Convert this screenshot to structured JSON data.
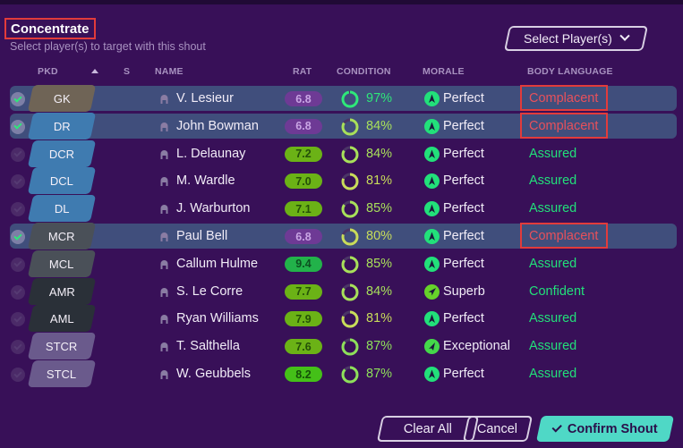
{
  "header": {
    "title": "Concentrate",
    "subtitle": "Select player(s) to target with this shout",
    "select_players_label": "Select Player(s)"
  },
  "columns": {
    "pkd": "PKD",
    "s": "S",
    "name": "NAME",
    "rat": "RAT",
    "condition": "CONDITION",
    "morale": "MORALE",
    "body_language": "BODY LANGUAGE"
  },
  "colors": {
    "background": "#381058",
    "selected_row": "#404e7c",
    "complacent": "#e8505b",
    "positive_body_language": "#22e07a",
    "confirm_button": "#4fd8c6",
    "highlight_box": "#e23b3b"
  },
  "players": [
    {
      "selected": true,
      "position": "GK",
      "position_color": "#6f6456",
      "name": "V. Lesieur",
      "rating": "6.8",
      "rating_bg": "#6e3a95",
      "rating_fg": "#c9a5e4",
      "condition": "97%",
      "condition_value": 0.97,
      "condition_color": "#2ee87a",
      "morale": "Perfect",
      "morale_icon": "arrow-up-icon",
      "morale_icon_color": "#22e07a",
      "body_language": "Complacent",
      "body_language_color": "#e8505b",
      "highlighted": true
    },
    {
      "selected": true,
      "position": "DR",
      "position_color": "#3f7bb0",
      "name": "John Bowman",
      "rating": "6.8",
      "rating_bg": "#6e3a95",
      "rating_fg": "#c9a5e4",
      "condition": "84%",
      "condition_value": 0.84,
      "condition_color": "#a8e05a",
      "morale": "Perfect",
      "morale_icon": "arrow-up-icon",
      "morale_icon_color": "#22e07a",
      "body_language": "Complacent",
      "body_language_color": "#e8505b",
      "highlighted": true
    },
    {
      "selected": false,
      "position": "DCR",
      "position_color": "#3f7bb0",
      "name": "L. Delaunay",
      "rating": "7.2",
      "rating_bg": "#6bb216",
      "rating_fg": "#245008",
      "condition": "84%",
      "condition_value": 0.84,
      "condition_color": "#a8e05a",
      "morale": "Perfect",
      "morale_icon": "arrow-up-icon",
      "morale_icon_color": "#22e07a",
      "body_language": "Assured",
      "body_language_color": "#22e07a",
      "highlighted": false
    },
    {
      "selected": false,
      "position": "DCL",
      "position_color": "#3f7bb0",
      "name": "M. Wardle",
      "rating": "7.0",
      "rating_bg": "#6bb216",
      "rating_fg": "#245008",
      "condition": "81%",
      "condition_value": 0.81,
      "condition_color": "#c8dc5a",
      "morale": "Perfect",
      "morale_icon": "arrow-up-icon",
      "morale_icon_color": "#22e07a",
      "body_language": "Assured",
      "body_language_color": "#22e07a",
      "highlighted": false
    },
    {
      "selected": false,
      "position": "DL",
      "position_color": "#3f7bb0",
      "name": "J. Warburton",
      "rating": "7.1",
      "rating_bg": "#6bb216",
      "rating_fg": "#245008",
      "condition": "85%",
      "condition_value": 0.85,
      "condition_color": "#a8e05a",
      "morale": "Perfect",
      "morale_icon": "arrow-up-icon",
      "morale_icon_color": "#22e07a",
      "body_language": "Assured",
      "body_language_color": "#22e07a",
      "highlighted": false
    },
    {
      "selected": true,
      "position": "MCR",
      "position_color": "#4a5058",
      "name": "Paul Bell",
      "rating": "6.8",
      "rating_bg": "#6e3a95",
      "rating_fg": "#c9a5e4",
      "condition": "80%",
      "condition_value": 0.8,
      "condition_color": "#c8dc5a",
      "morale": "Perfect",
      "morale_icon": "arrow-up-icon",
      "morale_icon_color": "#22e07a",
      "body_language": "Complacent",
      "body_language_color": "#e8505b",
      "highlighted": true
    },
    {
      "selected": false,
      "position": "MCL",
      "position_color": "#4a5058",
      "name": "Callum Hulme",
      "rating": "9.4",
      "rating_bg": "#22b24a",
      "rating_fg": "#0c5020",
      "condition": "85%",
      "condition_value": 0.85,
      "condition_color": "#a8e05a",
      "morale": "Perfect",
      "morale_icon": "arrow-up-icon",
      "morale_icon_color": "#22e07a",
      "body_language": "Assured",
      "body_language_color": "#22e07a",
      "highlighted": false
    },
    {
      "selected": false,
      "position": "AMR",
      "position_color": "#2a3038",
      "name": "S. Le Corre",
      "rating": "7.7",
      "rating_bg": "#6bb216",
      "rating_fg": "#245008",
      "condition": "84%",
      "condition_value": 0.84,
      "condition_color": "#a8e05a",
      "morale": "Superb",
      "morale_icon": "arrow-diagonal-icon",
      "morale_icon_color": "#66d22a",
      "body_language": "Confident",
      "body_language_color": "#22e07a",
      "highlighted": false
    },
    {
      "selected": false,
      "position": "AML",
      "position_color": "#2a3038",
      "name": "Ryan Williams",
      "rating": "7.9",
      "rating_bg": "#6bb216",
      "rating_fg": "#245008",
      "condition": "81%",
      "condition_value": 0.81,
      "condition_color": "#c8dc5a",
      "morale": "Perfect",
      "morale_icon": "arrow-up-icon",
      "morale_icon_color": "#22e07a",
      "body_language": "Assured",
      "body_language_color": "#22e07a",
      "highlighted": false
    },
    {
      "selected": false,
      "position": "STCR",
      "position_color": "#6a5a8c",
      "name": "T. Salthella",
      "rating": "7.6",
      "rating_bg": "#6bb216",
      "rating_fg": "#245008",
      "condition": "87%",
      "condition_value": 0.87,
      "condition_color": "#8ee05a",
      "morale": "Exceptional",
      "morale_icon": "arrow-diagonal-up-icon",
      "morale_icon_color": "#44d84a",
      "body_language": "Assured",
      "body_language_color": "#22e07a",
      "highlighted": false
    },
    {
      "selected": false,
      "position": "STCL",
      "position_color": "#6a5a8c",
      "name": "W. Geubbels",
      "rating": "8.2",
      "rating_bg": "#44c018",
      "rating_fg": "#145008",
      "condition": "87%",
      "condition_value": 0.87,
      "condition_color": "#8ee05a",
      "morale": "Perfect",
      "morale_icon": "arrow-up-icon",
      "morale_icon_color": "#22e07a",
      "body_language": "Assured",
      "body_language_color": "#22e07a",
      "highlighted": false
    }
  ],
  "footer": {
    "clear_all_label": "Clear All",
    "cancel_label": "Cancel",
    "confirm_label": "Confirm Shout"
  }
}
